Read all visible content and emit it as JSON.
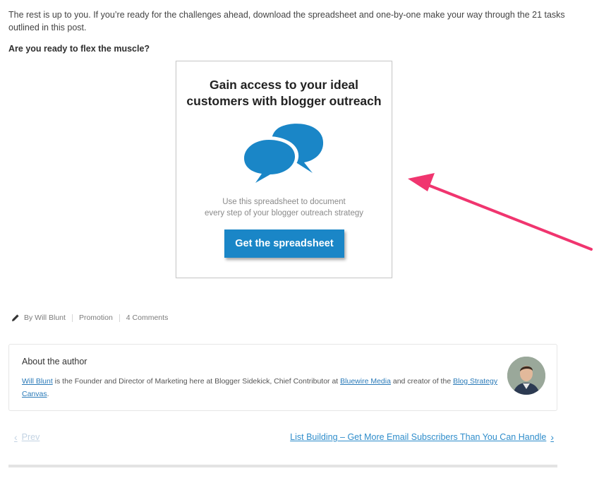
{
  "intro": {
    "text": "The rest is up to you. If you’re ready for the challenges ahead, download the spreadsheet and one-by-one make your way through the 21 tasks outlined in this post.",
    "question": "Are you ready to flex the muscle?"
  },
  "cta": {
    "title_line1": "Gain access to your ideal",
    "title_line2": "customers with blogger outreach",
    "subtitle_line1": "Use this spreadsheet to document",
    "subtitle_line2": "every step of your blogger outreach strategy",
    "button_label": "Get the spreadsheet",
    "icon": "speech-bubbles-icon",
    "accent_color": "#1a86c7",
    "arrow_color": "#f0356f"
  },
  "meta": {
    "icon": "pencil-icon",
    "author": "By Will Blunt",
    "category": "Promotion",
    "comments": "4 Comments"
  },
  "author_box": {
    "heading": "About the author",
    "name_link": "Will Blunt",
    "bio_part1": " is the Founder and Director of Marketing here at Blogger Sidekick, Chief Contributor at ",
    "company_link": "Bluewire Media",
    "bio_part2": " and creator of the ",
    "canvas_link": "Blog Strategy Canvas",
    "bio_end": "."
  },
  "post_nav": {
    "prev_label": "Prev",
    "next_label": "List Building – Get More Email Subscribers Than You Can Handle",
    "prev_icon": "chevron-left-icon",
    "next_icon": "chevron-right-icon"
  }
}
